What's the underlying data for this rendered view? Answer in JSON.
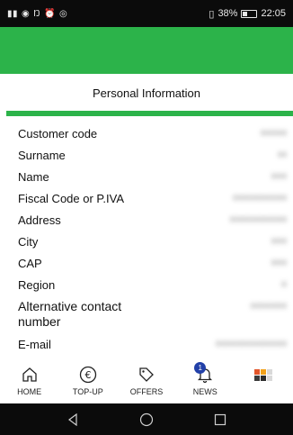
{
  "status_bar": {
    "left_icons": [
      "signal-icon",
      "eye-comfort-icon",
      "nfc-icon",
      "alarm-icon",
      "whatsapp-icon"
    ],
    "battery_percent": "38%",
    "time": "22:05"
  },
  "page": {
    "title": "Personal Information"
  },
  "fields": [
    {
      "label": "Customer code",
      "value": "••••••••"
    },
    {
      "label": "Surname",
      "value": "•••"
    },
    {
      "label": "Name",
      "value": "•••••"
    },
    {
      "label": "Fiscal Code or P.IVA",
      "value": "••••••••••••••••"
    },
    {
      "label": "Address",
      "value": "•••••••••••••••••"
    },
    {
      "label": "City",
      "value": "•••••"
    },
    {
      "label": "CAP",
      "value": "•••••"
    },
    {
      "label": "Region",
      "value": "••"
    },
    {
      "label": "Alternative contact number",
      "value": "•••••••••••"
    },
    {
      "label": "E-mail",
      "value": "•••••••••••••••••••••"
    }
  ],
  "bottom_nav": [
    {
      "label": "HOME",
      "icon": "home-icon"
    },
    {
      "label": "TOP-UP",
      "icon": "euro-icon"
    },
    {
      "label": "OFFERS",
      "icon": "tag-icon"
    },
    {
      "label": "NEWS",
      "icon": "bell-icon",
      "badge": "1"
    },
    {
      "label": "",
      "icon": "more-icon"
    }
  ],
  "colors": {
    "accent_green": "#2cb34a",
    "badge_blue": "#2240a8",
    "status_bar_bg": "#0b0b0b"
  }
}
